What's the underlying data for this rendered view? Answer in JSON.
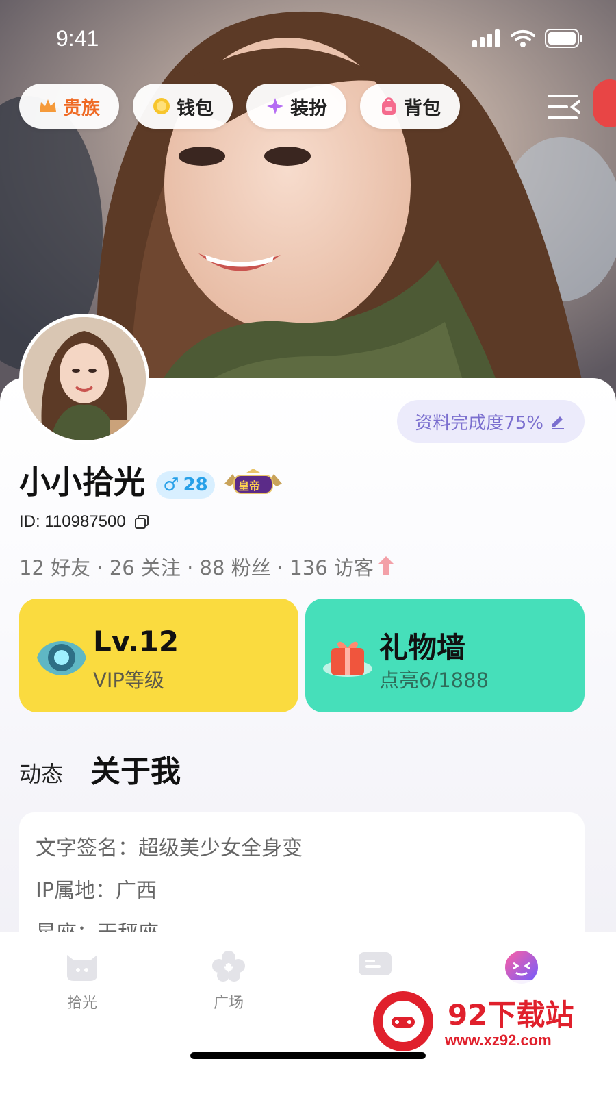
{
  "status_bar": {
    "time": "9:41"
  },
  "top_pills": [
    {
      "label": "贵族",
      "icon": "crown-icon"
    },
    {
      "label": "钱包",
      "icon": "coin-icon"
    },
    {
      "label": "装扮",
      "icon": "sparkle-icon"
    },
    {
      "label": "背包",
      "icon": "backpack-icon"
    }
  ],
  "profile": {
    "completion": "资料完成度75%",
    "name": "小小拾光",
    "gender_symbol": "♂",
    "age": "28",
    "rank_badge": "皇帝",
    "id_text": "ID: 110987500",
    "stats": "12 好友 · 26 关注 · 88 粉丝 · 136 访客"
  },
  "cards": {
    "vip": {
      "title": "Lv.12",
      "subtitle": "VIP等级"
    },
    "gift": {
      "title": "礼物墙",
      "subtitle": "点亮6/1888"
    }
  },
  "tabs": {
    "feed": "动态",
    "about": "关于我"
  },
  "about_rows": [
    "文字签名：超级美少女全身变",
    "IP属地：广西",
    "星座：天秤座"
  ],
  "tabbar": [
    {
      "label": "拾光",
      "icon": "cat-icon"
    },
    {
      "label": "广场",
      "icon": "flower-icon"
    },
    {
      "label": "",
      "icon": "message-icon"
    },
    {
      "label": "",
      "icon": "avatar-face-icon"
    }
  ],
  "watermark": {
    "name": "92下载站",
    "url": "www.xz92.com"
  },
  "colors": {
    "vip_card": "#fadb3f",
    "gift_card": "#46dfba",
    "completion_text": "#7b6fcf",
    "noble_text": "#ef6a24"
  }
}
